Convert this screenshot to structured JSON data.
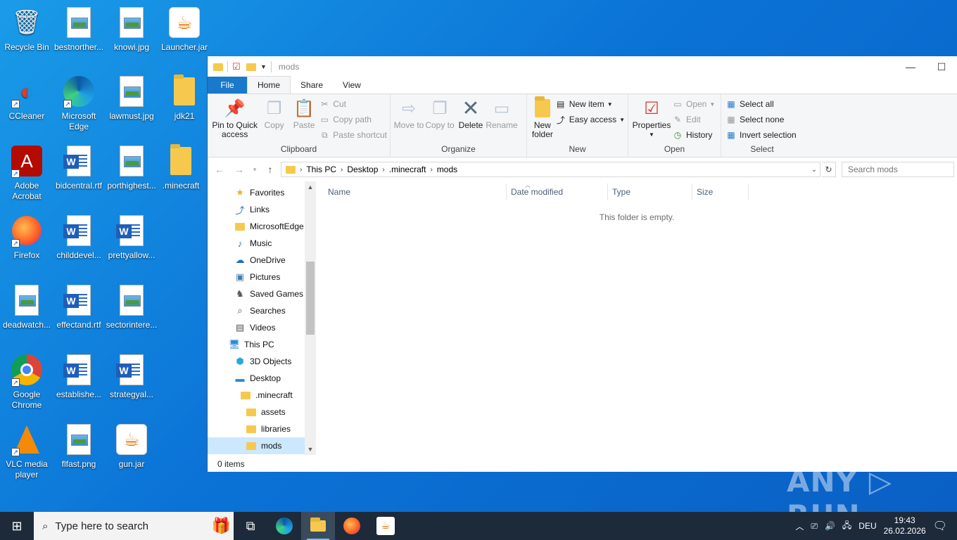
{
  "desktop": {
    "icons": [
      {
        "label": "Recycle Bin",
        "icon": "recycle-bin-icon"
      },
      {
        "label": "bestnorther...",
        "icon": "image-file-icon"
      },
      {
        "label": "knowi.jpg",
        "icon": "image-file-icon"
      },
      {
        "label": "Launcher.jar",
        "icon": "java-jar-icon"
      },
      {
        "label": "CCleaner",
        "icon": "ccleaner-icon"
      },
      {
        "label": "Microsoft Edge",
        "icon": "edge-icon"
      },
      {
        "label": "lawmust.jpg",
        "icon": "image-file-icon"
      },
      {
        "label": "jdk21",
        "icon": "folder-icon"
      },
      {
        "label": "Adobe Acrobat",
        "icon": "acrobat-icon"
      },
      {
        "label": "bidcentral.rtf",
        "icon": "word-doc-icon"
      },
      {
        "label": "porthighest...",
        "icon": "image-file-icon"
      },
      {
        "label": ".minecraft",
        "icon": "folder-icon"
      },
      {
        "label": "Firefox",
        "icon": "firefox-icon"
      },
      {
        "label": "childdevel...",
        "icon": "word-doc-icon"
      },
      {
        "label": "prettyallow...",
        "icon": "word-doc-icon"
      },
      {
        "label": "deadwatch...",
        "icon": "image-file-icon"
      },
      {
        "label": "effectand.rtf",
        "icon": "word-doc-icon"
      },
      {
        "label": "sectorintere...",
        "icon": "image-file-icon"
      },
      {
        "label": "Google Chrome",
        "icon": "chrome-icon"
      },
      {
        "label": "establishe...",
        "icon": "word-doc-icon"
      },
      {
        "label": "strategyal...",
        "icon": "word-doc-icon"
      },
      {
        "label": "VLC media player",
        "icon": "vlc-icon"
      },
      {
        "label": "flfast.png",
        "icon": "image-file-icon"
      },
      {
        "label": "gun.jar",
        "icon": "java-jar-icon"
      }
    ]
  },
  "explorer": {
    "title": "mods",
    "tabs": {
      "file": "File",
      "home": "Home",
      "share": "Share",
      "view": "View"
    },
    "ribbon": {
      "clipboard": {
        "title": "Clipboard",
        "pin": "Pin to Quick access",
        "copy": "Copy",
        "paste": "Paste",
        "cut": "Cut",
        "copy_path": "Copy path",
        "paste_shortcut": "Paste shortcut"
      },
      "organize": {
        "title": "Organize",
        "move_to": "Move to",
        "copy_to": "Copy to",
        "delete": "Delete",
        "rename": "Rename"
      },
      "new": {
        "title": "New",
        "new_folder": "New folder",
        "new_item": "New item",
        "easy_access": "Easy access"
      },
      "open": {
        "title": "Open",
        "properties": "Properties",
        "open": "Open",
        "edit": "Edit",
        "history": "History"
      },
      "select": {
        "title": "Select",
        "select_all": "Select all",
        "select_none": "Select none",
        "invert": "Invert selection"
      }
    },
    "address": {
      "crumbs": [
        "This PC",
        "Desktop",
        ".minecraft",
        "mods"
      ]
    },
    "search_placeholder": "Search mods",
    "nav": {
      "favorites": "Favorites",
      "links": "Links",
      "microsoftedge": "MicrosoftEdge",
      "music": "Music",
      "onedrive": "OneDrive",
      "pictures": "Pictures",
      "saved_games": "Saved Games",
      "searches": "Searches",
      "videos": "Videos",
      "this_pc": "This PC",
      "objects3d": "3D Objects",
      "desktop": "Desktop",
      "minecraft": ".minecraft",
      "assets": "assets",
      "libraries": "libraries",
      "mods": "mods"
    },
    "columns": {
      "name": "Name",
      "date": "Date modified",
      "type": "Type",
      "size": "Size"
    },
    "empty_message": "This folder is empty.",
    "status": "0 items"
  },
  "watermark": "ANY ▷ RUN",
  "taskbar": {
    "search_placeholder": "Type here to search",
    "language": "DEU",
    "time": "19:43",
    "date": "26.02.2026"
  }
}
